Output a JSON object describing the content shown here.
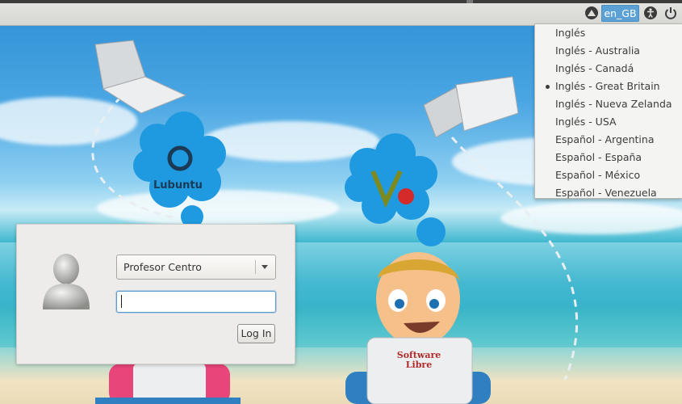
{
  "panel": {
    "language_indicator": "en_GB",
    "icons": [
      "network-icon",
      "accessibility-icon",
      "power-icon"
    ]
  },
  "language_menu": {
    "items": [
      {
        "label": "Inglés",
        "selected": false
      },
      {
        "label": "Inglés - Australia",
        "selected": false
      },
      {
        "label": "Inglés - Canadá",
        "selected": false
      },
      {
        "label": "Inglés - Great Britain",
        "selected": true
      },
      {
        "label": "Inglés - Nueva Zelanda",
        "selected": false
      },
      {
        "label": "Inglés - USA",
        "selected": false
      },
      {
        "label": "Español - Argentina",
        "selected": false
      },
      {
        "label": "Español - España",
        "selected": false
      },
      {
        "label": "Español - México",
        "selected": false
      },
      {
        "label": "Español - Venezuela",
        "selected": false
      }
    ]
  },
  "wallpaper": {
    "cloud_logo_left": "Lubuntu",
    "shirt_text": "Software Libre"
  },
  "login": {
    "user_selected": "Profesor Centro",
    "password_value": "",
    "login_button": "Log In"
  },
  "colors": {
    "panel_bg": "#dcdcd8",
    "accent_blue": "#5ca1d6",
    "menu_bg": "#f4f4f3",
    "dialog_bg": "#edecea"
  }
}
